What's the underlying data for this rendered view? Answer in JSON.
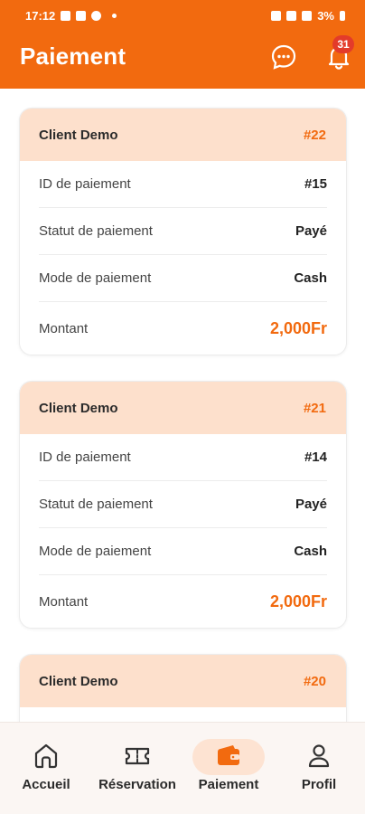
{
  "status": {
    "time": "17:12",
    "battery": "3%"
  },
  "header": {
    "title": "Paiement",
    "notification_count": "31"
  },
  "payments": [
    {
      "client": "Client Demo",
      "number": "#22",
      "rows": [
        {
          "label": "ID de paiement",
          "value": "#15"
        },
        {
          "label": "Statut de paiement",
          "value": "Payé"
        },
        {
          "label": "Mode de paiement",
          "value": "Cash"
        },
        {
          "label": "Montant",
          "value": "2,000Fr"
        }
      ]
    },
    {
      "client": "Client Demo",
      "number": "#21",
      "rows": [
        {
          "label": "ID de paiement",
          "value": "#14"
        },
        {
          "label": "Statut de paiement",
          "value": "Payé"
        },
        {
          "label": "Mode de paiement",
          "value": "Cash"
        },
        {
          "label": "Montant",
          "value": "2,000Fr"
        }
      ]
    },
    {
      "client": "Client Demo",
      "number": "#20"
    }
  ],
  "nav": {
    "items": [
      {
        "label": "Accueil",
        "icon": "home-icon"
      },
      {
        "label": "Réservation",
        "icon": "ticket-icon"
      },
      {
        "label": "Paiement",
        "icon": "wallet-icon",
        "active": true
      },
      {
        "label": "Profil",
        "icon": "user-icon"
      }
    ]
  },
  "colors": {
    "accent": "#f26a0f",
    "card_header": "#fde0cc",
    "badge": "#e33b2a"
  }
}
